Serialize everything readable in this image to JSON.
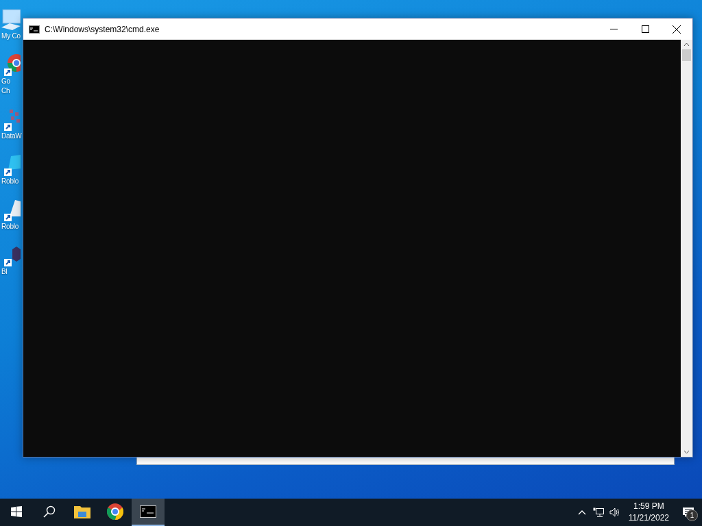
{
  "desktop_icons": [
    {
      "kind": "computer",
      "lines": [
        "My Co"
      ]
    },
    {
      "kind": "browser",
      "lines": [
        "Go",
        "Ch"
      ]
    },
    {
      "kind": "grid",
      "lines": [
        "DataW"
      ]
    },
    {
      "kind": "studio",
      "lines": [
        "Roblo"
      ]
    },
    {
      "kind": "player",
      "lines": [
        "Roblo"
      ]
    },
    {
      "kind": "hex",
      "lines": [
        "Bl"
      ]
    }
  ],
  "window": {
    "title": "C:\\Windows\\system32\\cmd.exe"
  },
  "taskbar": {
    "apps": [
      {
        "kind": "folder",
        "selected": false
      },
      {
        "kind": "browser",
        "selected": false
      },
      {
        "kind": "terminal",
        "selected": true
      }
    ],
    "clock": {
      "time": "1:59 PM",
      "date": "11/21/2022"
    },
    "notifications": {
      "count": "1"
    }
  }
}
